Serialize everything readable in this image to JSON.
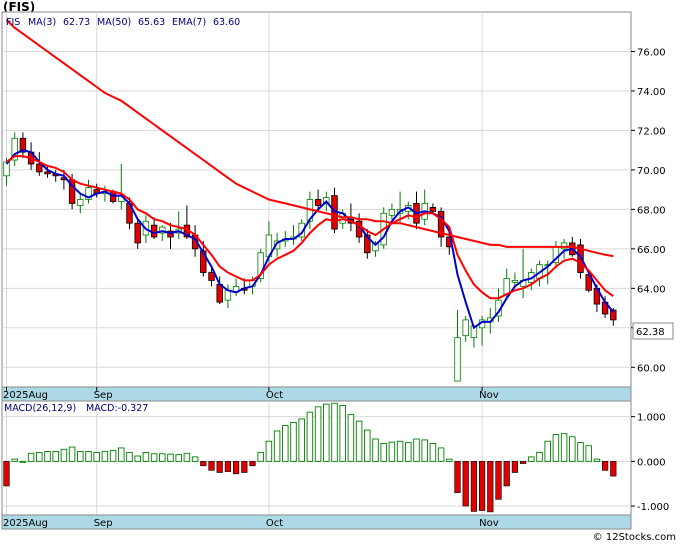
{
  "title": "(FIS)",
  "credit": "© 12Stocks.com",
  "chart_data": [
    {
      "type": "candlestick",
      "legend": {
        "ticker": "FIS",
        "ma3": "MA(3)",
        "ma3_val": "62.73",
        "ma50": "MA(50)",
        "ma50_val": "65.63",
        "ema7": "EMA(7)",
        "ema7_val": "63.60"
      },
      "last_price_label": "62.38",
      "ylim": [
        59.0,
        78.0
      ],
      "y_ticks": [
        60,
        62,
        64,
        66,
        68,
        70,
        72,
        74,
        76
      ],
      "y_tick_labels": [
        "60.00",
        "62.00",
        "64.00",
        "66.00",
        "68.00",
        "70.00",
        "72.00",
        "74.00",
        "76.00"
      ],
      "x_tick_labels": [
        {
          "label": "2025Aug",
          "index": 0
        },
        {
          "label": "Sep",
          "index": 11
        },
        {
          "label": "Oct",
          "index": 32
        },
        {
          "label": "Nov",
          "index": 58
        }
      ],
      "candles": [
        [
          69.7,
          70.6,
          69.2,
          70.4
        ],
        [
          70.5,
          71.9,
          70.2,
          71.6
        ],
        [
          71.6,
          71.9,
          70.6,
          70.9
        ],
        [
          70.9,
          71.4,
          70.0,
          70.3
        ],
        [
          70.3,
          70.9,
          69.7,
          69.9
        ],
        [
          69.9,
          70.2,
          69.6,
          69.8
        ],
        [
          69.8,
          70.0,
          69.4,
          69.7
        ],
        [
          69.6,
          70.0,
          69.0,
          69.5
        ],
        [
          69.5,
          69.8,
          68.0,
          68.3
        ],
        [
          68.2,
          68.8,
          67.8,
          68.5
        ],
        [
          68.5,
          69.5,
          68.3,
          69.1
        ],
        [
          69.0,
          69.3,
          68.6,
          68.8
        ],
        [
          68.8,
          69.2,
          68.4,
          68.9
        ],
        [
          68.9,
          69.0,
          68.3,
          68.4
        ],
        [
          68.4,
          70.3,
          68.0,
          68.7
        ],
        [
          68.3,
          68.6,
          67.0,
          67.3
        ],
        [
          67.3,
          67.6,
          66.0,
          66.3
        ],
        [
          66.7,
          67.7,
          66.3,
          67.4
        ],
        [
          67.2,
          67.6,
          66.5,
          66.6
        ],
        [
          66.8,
          67.2,
          66.4,
          67.1
        ],
        [
          66.9,
          67.3,
          66.0,
          66.6
        ],
        [
          66.8,
          67.9,
          66.5,
          67.0
        ],
        [
          67.2,
          68.2,
          66.5,
          66.6
        ],
        [
          66.7,
          67.2,
          65.6,
          66.0
        ],
        [
          65.9,
          66.4,
          64.6,
          64.8
        ],
        [
          64.8,
          65.0,
          64.1,
          64.4
        ],
        [
          64.2,
          64.6,
          63.2,
          63.3
        ],
        [
          63.4,
          64.2,
          63.0,
          63.9
        ],
        [
          63.8,
          64.5,
          63.6,
          64.1
        ],
        [
          64.0,
          64.5,
          63.7,
          63.9
        ],
        [
          64.1,
          64.6,
          63.7,
          64.4
        ],
        [
          64.5,
          66.0,
          64.3,
          65.8
        ],
        [
          65.6,
          67.4,
          65.3,
          66.7
        ],
        [
          66.0,
          66.8,
          65.6,
          66.4
        ],
        [
          66.4,
          66.9,
          66.1,
          66.5
        ],
        [
          66.5,
          67.2,
          66.2,
          66.6
        ],
        [
          66.6,
          67.5,
          66.4,
          67.3
        ],
        [
          67.4,
          68.9,
          67.0,
          68.5
        ],
        [
          68.5,
          69.0,
          68.0,
          68.2
        ],
        [
          68.3,
          68.9,
          67.9,
          68.6
        ],
        [
          68.7,
          69.1,
          66.8,
          67.0
        ],
        [
          67.3,
          68.0,
          67.0,
          67.8
        ],
        [
          67.5,
          68.3,
          66.9,
          67.3
        ],
        [
          67.4,
          67.8,
          66.3,
          66.6
        ],
        [
          66.7,
          67.0,
          65.5,
          65.8
        ],
        [
          65.9,
          66.4,
          65.6,
          66.3
        ],
        [
          66.2,
          68.1,
          66.0,
          67.8
        ],
        [
          67.7,
          68.3,
          67.5,
          68.0
        ],
        [
          67.8,
          68.9,
          67.3,
          68.0
        ],
        [
          67.9,
          68.4,
          67.5,
          68.2
        ],
        [
          68.3,
          68.9,
          67.0,
          67.3
        ],
        [
          67.5,
          69.0,
          67.2,
          68.3
        ],
        [
          68.1,
          68.3,
          67.8,
          67.9
        ],
        [
          67.9,
          68.1,
          66.1,
          66.6
        ],
        [
          66.6,
          66.9,
          65.7,
          66.1
        ],
        [
          59.3,
          62.9,
          59.3,
          61.5
        ],
        [
          61.6,
          62.6,
          61.3,
          62.4
        ],
        [
          61.5,
          62.1,
          61.0,
          62.1
        ],
        [
          62.0,
          62.6,
          61.1,
          62.4
        ],
        [
          62.3,
          63.0,
          61.7,
          62.5
        ],
        [
          62.6,
          64.0,
          62.3,
          63.4
        ],
        [
          63.7,
          65.0,
          63.5,
          64.5
        ],
        [
          64.3,
          64.8,
          64.0,
          64.4
        ],
        [
          64.1,
          66.0,
          63.5,
          64.4
        ],
        [
          64.3,
          65.0,
          63.9,
          64.8
        ],
        [
          64.5,
          65.4,
          64.1,
          65.2
        ],
        [
          65.2,
          65.4,
          64.2,
          65.2
        ],
        [
          65.3,
          66.4,
          65.0,
          66.1
        ],
        [
          66.0,
          66.5,
          65.5,
          66.3
        ],
        [
          66.3,
          66.6,
          65.6,
          65.7
        ],
        [
          66.2,
          66.5,
          64.5,
          64.8
        ],
        [
          64.7,
          64.9,
          63.8,
          63.9
        ],
        [
          64.0,
          64.2,
          62.8,
          63.2
        ],
        [
          63.3,
          63.6,
          62.5,
          62.7
        ],
        [
          62.9,
          63.0,
          62.1,
          62.4
        ]
      ],
      "series": [
        {
          "name": "MA(3)",
          "color": "#0000cc",
          "values": [
            70.3,
            70.8,
            71.0,
            70.9,
            70.4,
            70.0,
            69.8,
            69.7,
            69.2,
            68.8,
            68.6,
            68.8,
            68.9,
            68.7,
            68.7,
            68.3,
            67.5,
            67.0,
            66.8,
            66.9,
            66.8,
            66.9,
            66.7,
            66.5,
            65.8,
            65.1,
            64.2,
            63.9,
            63.8,
            64.0,
            64.1,
            64.7,
            65.6,
            66.3,
            66.5,
            66.5,
            66.8,
            67.5,
            68.0,
            68.4,
            67.9,
            67.8,
            67.4,
            67.2,
            66.6,
            66.2,
            66.6,
            67.4,
            67.9,
            68.1,
            67.8,
            67.9,
            67.8,
            67.6,
            66.9,
            64.7,
            63.3,
            62.0,
            62.3,
            62.3,
            62.8,
            63.5,
            64.1,
            64.4,
            64.5,
            64.8,
            65.1,
            65.5,
            65.9,
            66.0,
            65.6,
            64.8,
            64.0,
            63.3,
            62.8
          ]
        },
        {
          "name": "MA(50)",
          "color": "#ff0000",
          "values": [
            77.6,
            77.2,
            76.9,
            76.6,
            76.3,
            76.0,
            75.7,
            75.4,
            75.1,
            74.8,
            74.5,
            74.2,
            73.9,
            73.7,
            73.5,
            73.2,
            72.9,
            72.6,
            72.3,
            72.0,
            71.7,
            71.4,
            71.1,
            70.8,
            70.5,
            70.2,
            69.9,
            69.6,
            69.3,
            69.1,
            68.9,
            68.7,
            68.5,
            68.4,
            68.3,
            68.2,
            68.1,
            68.0,
            67.9,
            67.8,
            67.7,
            67.6,
            67.6,
            67.5,
            67.5,
            67.4,
            67.4,
            67.3,
            67.3,
            67.2,
            67.1,
            67.0,
            66.9,
            66.8,
            66.7,
            66.6,
            66.5,
            66.4,
            66.3,
            66.2,
            66.2,
            66.1,
            66.1,
            66.1,
            66.1,
            66.1,
            66.1,
            66.1,
            66.1,
            66.1,
            66.0,
            65.9,
            65.8,
            65.7,
            65.63
          ]
        },
        {
          "name": "EMA(7)",
          "color": "#ff0000",
          "values": [
            70.4,
            70.7,
            70.7,
            70.6,
            70.4,
            70.2,
            70.1,
            69.9,
            69.5,
            69.3,
            69.2,
            69.1,
            69.0,
            68.9,
            68.8,
            68.5,
            68.0,
            67.8,
            67.5,
            67.4,
            67.2,
            67.1,
            67.0,
            66.7,
            66.2,
            65.7,
            65.1,
            64.8,
            64.6,
            64.4,
            64.4,
            64.7,
            65.2,
            65.5,
            65.7,
            65.9,
            66.3,
            66.8,
            67.2,
            67.5,
            67.4,
            67.5,
            67.4,
            67.2,
            66.9,
            66.7,
            67.0,
            67.3,
            67.5,
            67.7,
            67.6,
            67.8,
            67.8,
            67.5,
            67.1,
            65.7,
            64.9,
            64.2,
            63.8,
            63.5,
            63.5,
            63.7,
            63.9,
            64.0,
            64.2,
            64.5,
            64.7,
            65.1,
            65.4,
            65.5,
            65.3,
            64.9,
            64.4,
            63.9,
            63.6
          ]
        }
      ]
    },
    {
      "type": "bar",
      "legend": {
        "label": "MACD(26,12,9)",
        "value_label": "MACD:-0.327"
      },
      "ylim": [
        -1.2,
        1.35
      ],
      "y_ticks": [
        1.0,
        0.0,
        -1.0
      ],
      "y_tick_labels": [
        "1.000",
        "0.000",
        "-1.000"
      ],
      "x_tick_labels": [
        {
          "label": "2025Aug",
          "index": 0
        },
        {
          "label": "Sep",
          "index": 11
        },
        {
          "label": "Oct",
          "index": 32
        },
        {
          "label": "Nov",
          "index": 58
        }
      ],
      "values": [
        -0.55,
        0.05,
        0.0,
        0.18,
        0.2,
        0.22,
        0.22,
        0.27,
        0.32,
        0.22,
        0.22,
        0.2,
        0.22,
        0.24,
        0.3,
        0.2,
        0.12,
        0.2,
        0.17,
        0.17,
        0.16,
        0.15,
        0.18,
        0.1,
        -0.1,
        -0.2,
        -0.25,
        -0.23,
        -0.28,
        -0.25,
        -0.1,
        0.2,
        0.45,
        0.68,
        0.8,
        0.87,
        0.95,
        1.1,
        1.22,
        1.28,
        1.3,
        1.25,
        1.05,
        0.9,
        0.7,
        0.5,
        0.4,
        0.43,
        0.45,
        0.42,
        0.5,
        0.48,
        0.4,
        0.3,
        0.05,
        -0.7,
        -1.0,
        -1.12,
        -1.1,
        -1.13,
        -0.85,
        -0.55,
        -0.25,
        -0.05,
        0.1,
        0.2,
        0.45,
        0.6,
        0.62,
        0.55,
        0.42,
        0.35,
        0.05,
        -0.2,
        -0.33
      ]
    }
  ]
}
